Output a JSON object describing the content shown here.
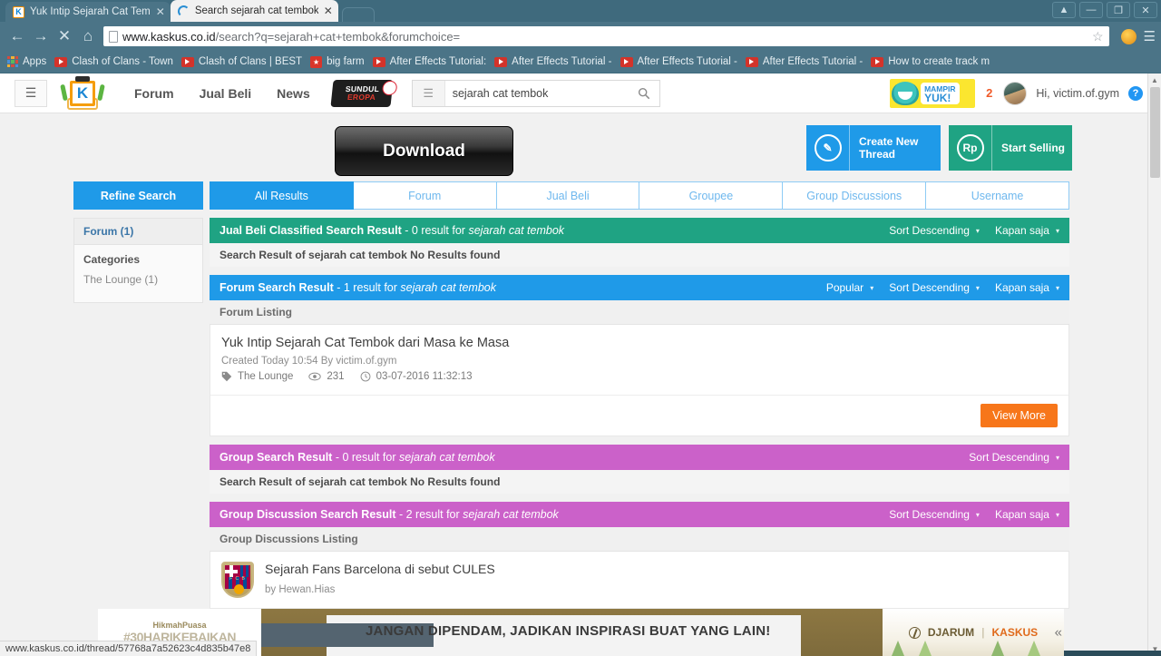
{
  "browser": {
    "tabs": [
      {
        "title": "Yuk Intip Sejarah Cat Tem",
        "favicon": "K",
        "state": "inactive",
        "close": "✕"
      },
      {
        "title": "Search sejarah cat tembok",
        "favicon": "loading-spinner",
        "state": "active",
        "close": "✕"
      }
    ],
    "window_controls": {
      "user": "▲",
      "minimize": "—",
      "maximize": "❐",
      "close": "✕"
    },
    "nav": {
      "back": "←",
      "forward": "→",
      "stop": "✕",
      "home": "⌂"
    },
    "url": {
      "domain": "www.kaskus.co.id",
      "path": "/search?q=sejarah+cat+tembok&forumchoice=",
      "star": "☆"
    },
    "bookmarks": [
      {
        "label": "Apps",
        "icon": "apps-grid-icon"
      },
      {
        "label": "Clash of Clans - Town",
        "icon": "youtube-icon"
      },
      {
        "label": "Clash of Clans | BEST",
        "icon": "youtube-icon"
      },
      {
        "label": "big farm",
        "icon": "bigfarm-icon"
      },
      {
        "label": "After Effects Tutorial:",
        "icon": "youtube-icon"
      },
      {
        "label": "After Effects Tutorial -",
        "icon": "youtube-icon"
      },
      {
        "label": "After Effects Tutorial -",
        "icon": "youtube-icon"
      },
      {
        "label": "After Effects Tutorial -",
        "icon": "youtube-icon"
      },
      {
        "label": "How to create track m",
        "icon": "youtube-icon"
      }
    ]
  },
  "site_header": {
    "menu_icon": "☰",
    "logo_letter": "K",
    "nav_links": [
      "Forum",
      "Jual Beli",
      "News"
    ],
    "promo_logo": {
      "line1": "SUNDUL",
      "line2": "EROPA"
    },
    "search": {
      "value": "sejarah cat tembok",
      "placeholder": "Search",
      "burger_icon": "☰",
      "go_icon": "⌕"
    },
    "mampir": {
      "line1": "MAMPIR",
      "line2": "YUK!"
    },
    "notification_count": "2",
    "greeting": "Hi, victim.of.gym",
    "help_icon": "?"
  },
  "ad_top": {
    "download_label": "Download"
  },
  "cta": {
    "create_thread": {
      "label": "Create New Thread",
      "line1": "Create New",
      "line2": "Thread",
      "icon": "pencil-icon"
    },
    "start_selling": {
      "label": "Start Selling",
      "icon": "Rp"
    }
  },
  "sidebar": {
    "refine_label": "Refine Search",
    "facet_head": "Forum (1)",
    "categories_label": "Categories",
    "category": {
      "name": "The Lounge",
      "count": "(1)"
    }
  },
  "tabs": [
    {
      "label": "All Results",
      "active": true
    },
    {
      "label": "Forum",
      "active": false
    },
    {
      "label": "Jual Beli",
      "active": false
    },
    {
      "label": "Groupee",
      "active": false
    },
    {
      "label": "Group Discussions",
      "active": false
    },
    {
      "label": "Username",
      "active": false
    }
  ],
  "query": "sejarah cat tembok",
  "blocks": {
    "jualbeli": {
      "title": "Jual Beli Classified Search Result",
      "count_text": "- 0 result for",
      "query": "sejarah cat tembok",
      "sorts": [
        {
          "label": "Sort Descending",
          "caret": "▾"
        },
        {
          "label": "Kapan saja",
          "caret": "▾"
        }
      ],
      "no_results": "Search Result of sejarah cat tembok No Results found"
    },
    "forum": {
      "title": "Forum Search Result",
      "count_text": "- 1 result for",
      "query": "sejarah cat tembok",
      "sorts": [
        {
          "label": "Popular",
          "caret": "▾"
        },
        {
          "label": "Sort Descending",
          "caret": "▾"
        },
        {
          "label": "Kapan saja",
          "caret": "▾"
        }
      ],
      "listing_label": "Forum Listing",
      "thread": {
        "title": "Yuk Intip Sejarah Cat Tembok dari Masa ke Masa",
        "meta": "Created Today 10:54 By victim.of.gym",
        "tag": "The Lounge",
        "views": "231",
        "timestamp": "03-07-2016 11:32:13"
      },
      "view_more": "View More"
    },
    "group": {
      "title": "Group Search Result",
      "count_text": "- 0 result for",
      "query": "sejarah cat tembok",
      "sorts": [
        {
          "label": "Sort Descending",
          "caret": "▾"
        }
      ],
      "no_results": "Search Result of sejarah cat tembok No Results found"
    },
    "group_discussion": {
      "title": "Group Discussion Search Result",
      "count_text": "- 2 result for",
      "query": "sejarah cat tembok",
      "sorts": [
        {
          "label": "Sort Descending",
          "caret": "▾"
        },
        {
          "label": "Kapan saja",
          "caret": "▾"
        }
      ],
      "listing_label": "Group Discussions Listing",
      "item": {
        "title": "Sejarah Fans Barcelona di sebut CULES",
        "by": "by Hewan.Hias",
        "icon": "fc-barcelona-crest-icon"
      }
    }
  },
  "bottom_ad": {
    "left_line1": "HikmahPuasa",
    "left_tag": "#30HARIKEBAIKAN",
    "banner_text": "JANGAN DIPENDAM, JADIKAN INSPIRASI BUAT YANG LAIN!",
    "brand_left": "DJARUM",
    "brand_right": "KASKUS",
    "collapse_icon": "«"
  },
  "status_bar": {
    "url": "www.kaskus.co.id/thread/57768a7a52623c4d835b47e8"
  },
  "colors": {
    "accent_blue": "#1f9ae8",
    "teal": "#1fa383",
    "purple": "#cb61c9",
    "orange": "#f7761a",
    "chrome": "#4b7487"
  }
}
